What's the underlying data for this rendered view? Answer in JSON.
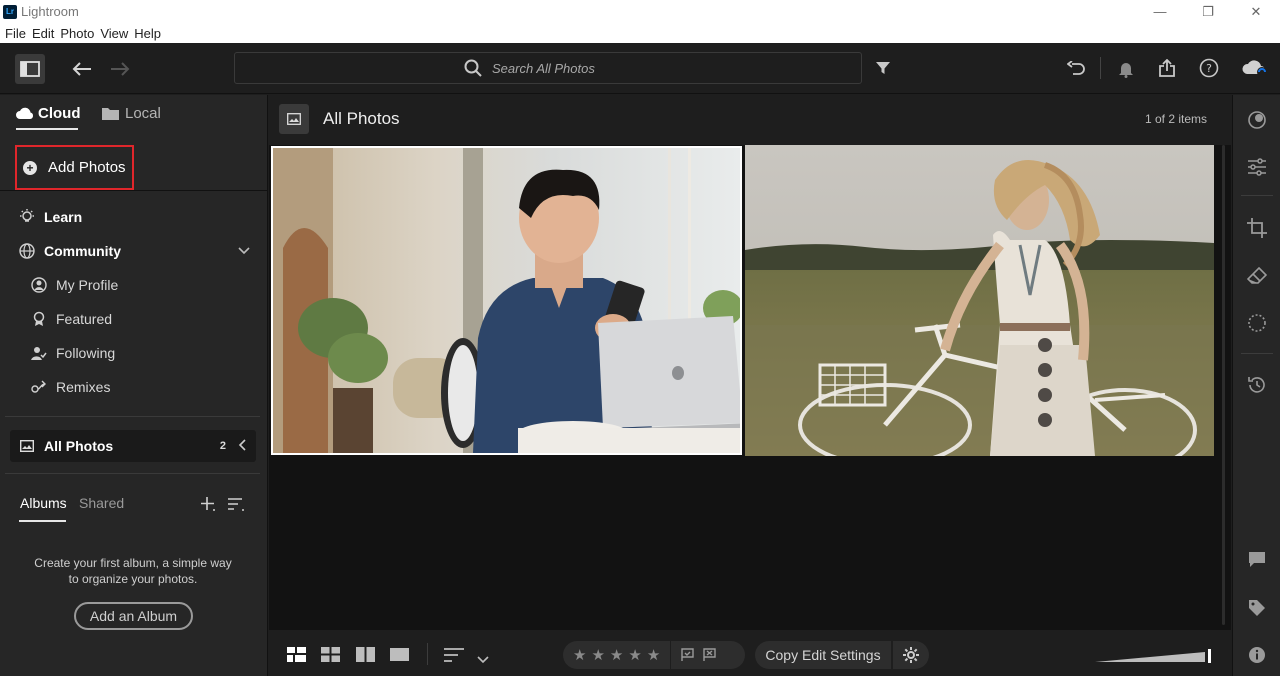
{
  "window": {
    "title": "Lightroom",
    "logo": "Lr"
  },
  "menu": [
    "File",
    "Edit",
    "Photo",
    "View",
    "Help"
  ],
  "toolbar": {
    "search_placeholder": "Search All Photos"
  },
  "left_panel": {
    "source_tabs": {
      "cloud": "Cloud",
      "local": "Local"
    },
    "add_photos": "Add Photos",
    "learn": "Learn",
    "community": "Community",
    "community_items": [
      "My Profile",
      "Featured",
      "Following",
      "Remixes"
    ],
    "all_photos": {
      "label": "All Photos",
      "count": "2"
    },
    "album_tabs": {
      "albums": "Albums",
      "shared": "Shared"
    },
    "empty_message": "Create your first album, a simple way to organize your photos.",
    "add_album": "Add an Album"
  },
  "content": {
    "title": "All Photos",
    "count_text": "1 of 2 items",
    "photos": [
      "photo-man-with-phone-and-laptop",
      "photo-woman-with-bicycle"
    ]
  },
  "bottom": {
    "copy_edit": "Copy Edit Settings",
    "stars": 5
  },
  "colors": {
    "highlight_border": "#e0262b",
    "background": "#1e1e1e",
    "panel": "#262626"
  }
}
